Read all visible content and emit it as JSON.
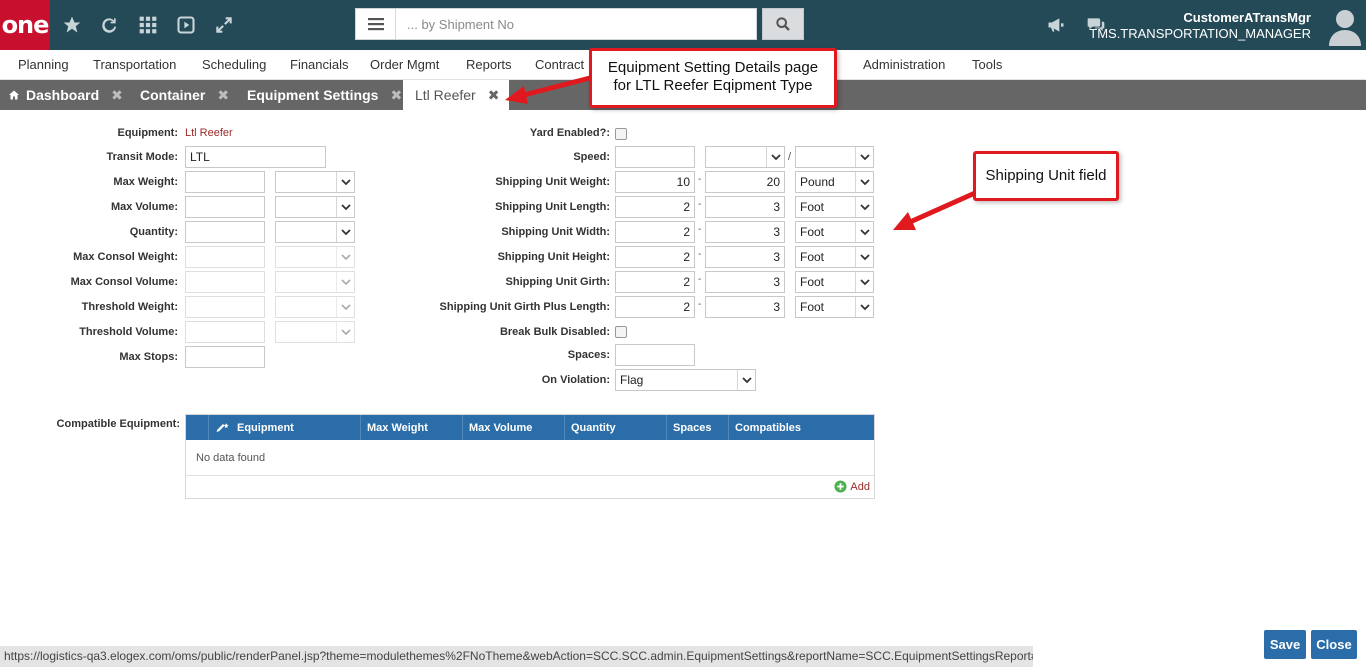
{
  "app": {
    "logo_text": "one"
  },
  "search": {
    "placeholder": "... by Shipment No"
  },
  "user": {
    "name": "CustomerATransMgr",
    "role": "TMS.TRANSPORTATION_MANAGER"
  },
  "menu": [
    "Planning",
    "Transportation",
    "Scheduling",
    "Financials",
    "Order Mgmt",
    "Reports",
    "Contract",
    "Administration",
    "Tools"
  ],
  "tabs": [
    {
      "label": "Dashboard"
    },
    {
      "label": "Container"
    },
    {
      "label": "Equipment Settings"
    },
    {
      "label": "Ltl Reefer"
    }
  ],
  "form": {
    "left": {
      "equipment_label": "Equipment:",
      "equipment_value": "Ltl Reefer",
      "transit_mode_label": "Transit Mode:",
      "transit_mode_value": "LTL",
      "max_weight_label": "Max Weight:",
      "max_volume_label": "Max Volume:",
      "quantity_label": "Quantity:",
      "max_consol_weight_label": "Max Consol Weight:",
      "max_consol_volume_label": "Max Consol Volume:",
      "threshold_weight_label": "Threshold Weight:",
      "threshold_volume_label": "Threshold Volume:",
      "max_stops_label": "Max Stops:"
    },
    "right": {
      "yard_enabled_label": "Yard Enabled?:",
      "speed_label": "Speed:",
      "speed_sep": "/",
      "rows": [
        {
          "label": "Shipping Unit Weight:",
          "min": "10",
          "max": "20",
          "unit": "Pound"
        },
        {
          "label": "Shipping Unit Length:",
          "min": "2",
          "max": "3",
          "unit": "Foot"
        },
        {
          "label": "Shipping Unit Width:",
          "min": "2",
          "max": "3",
          "unit": "Foot"
        },
        {
          "label": "Shipping Unit Height:",
          "min": "2",
          "max": "3",
          "unit": "Foot"
        },
        {
          "label": "Shipping Unit Girth:",
          "min": "2",
          "max": "3",
          "unit": "Foot"
        },
        {
          "label": "Shipping Unit Girth Plus Length:",
          "min": "2",
          "max": "3",
          "unit": "Foot"
        }
      ],
      "range_sep": "-",
      "break_bulk_label": "Break Bulk Disabled:",
      "spaces_label": "Spaces:",
      "on_violation_label": "On Violation:",
      "on_violation_value": "Flag"
    },
    "compatible_label": "Compatible Equipment:"
  },
  "grid": {
    "columns": [
      "Equipment",
      "Max Weight",
      "Max Volume",
      "Quantity",
      "Spaces",
      "Compatibles"
    ],
    "empty_text": "No data found",
    "add_label": "Add"
  },
  "callouts": {
    "details": "Equipment Setting Details page for LTL Reefer Eqipment Type",
    "shipping_unit": "Shipping Unit field"
  },
  "footer": {
    "status_url": "https://logistics-qa3.elogex.com/oms/public/renderPanel.jsp?theme=modulethemes%2FNoTheme&webAction=SCC.SCC.admin.EquipmentSettings&reportName=SCC.EquipmentSettingsReport#",
    "save_label": "Save",
    "close_label": "Close"
  },
  "colors": {
    "topbar": "#244a58",
    "logo": "#c8102e",
    "accent": "#2a6da9",
    "callout_border": "#e0191f",
    "tabbar": "#666666"
  }
}
